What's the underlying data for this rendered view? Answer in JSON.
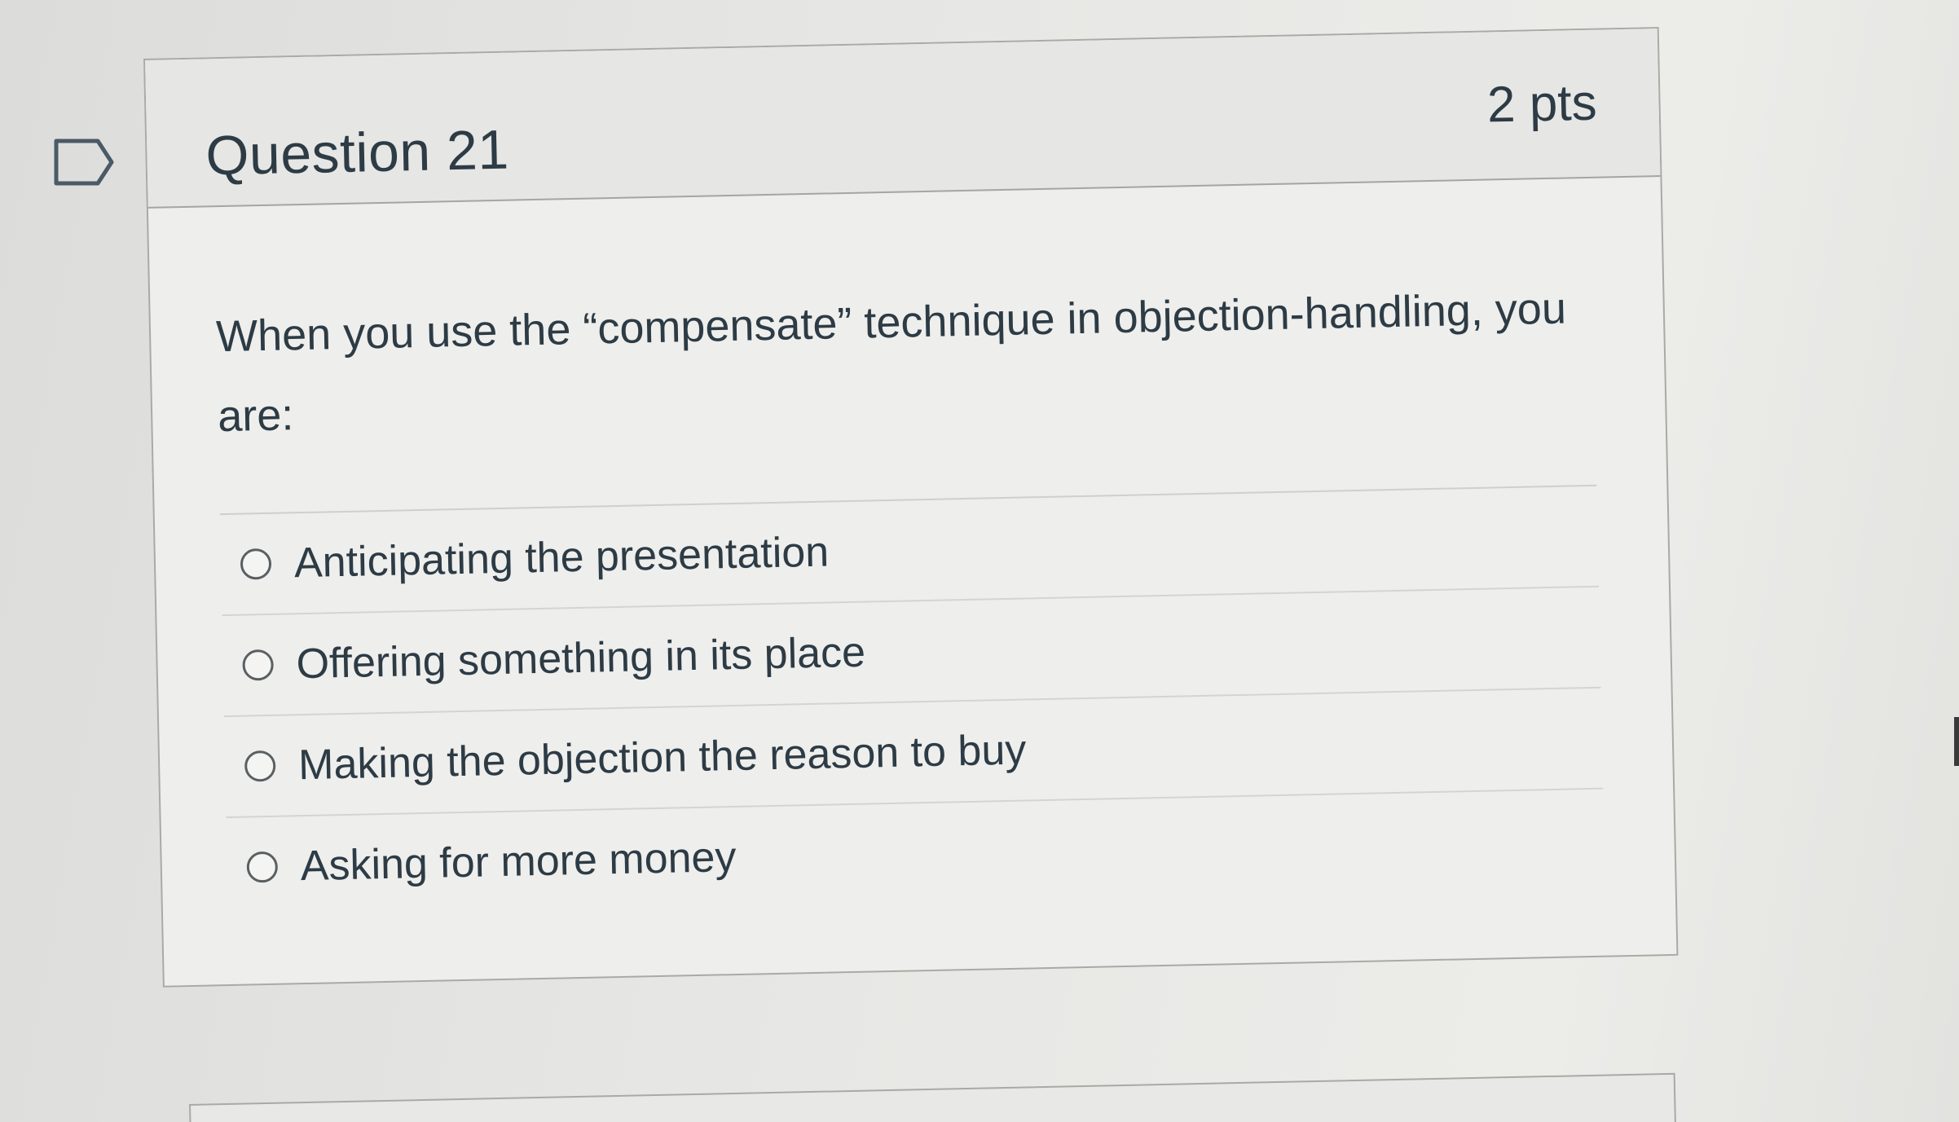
{
  "question": {
    "title": "Question 21",
    "points": "2 pts",
    "text": "When you use the “compensate” technique in objection-handling, you are:",
    "flag_icon": "bookmark-flag-icon",
    "answers": [
      {
        "label": "Anticipating the presentation",
        "selected": false
      },
      {
        "label": "Offering something in its place",
        "selected": false
      },
      {
        "label": "Making the objection the reason to buy",
        "selected": false
      },
      {
        "label": "Asking for more money",
        "selected": false
      }
    ]
  },
  "colors": {
    "text": "#2d3b45",
    "border": "#a9a9a6",
    "header_bg": "#e6e6e4",
    "card_bg": "#eeeeec"
  }
}
